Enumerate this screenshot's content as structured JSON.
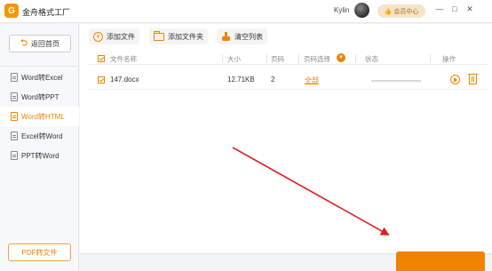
{
  "app": {
    "title": "金舟格式工厂",
    "logo_glyph": "G",
    "user": "Kylin",
    "member_label": "会员中心"
  },
  "window_controls": [
    "—",
    "□",
    "✕"
  ],
  "sidebar": {
    "back_label": "返回首页",
    "items": [
      {
        "label": "Word转Excel",
        "active": false
      },
      {
        "label": "Word转PPT",
        "active": false
      },
      {
        "label": "Word转HTML",
        "active": true
      },
      {
        "label": "Excel转Word",
        "active": false
      },
      {
        "label": "PPT转Word",
        "active": false
      }
    ],
    "bottom_button": "PDF转文件"
  },
  "toolbar": {
    "add_file": "添加文件",
    "add_folder": "添加文件夹",
    "clear_list": "清空列表"
  },
  "table": {
    "headers": {
      "name": "文件名称",
      "size": "大小",
      "pages": "页码",
      "page_select": "页码选择",
      "status": "状态",
      "actions": "操作"
    },
    "rows": [
      {
        "name": "147.docx",
        "size": "12.71KB",
        "pages": "2",
        "page_select": "全部",
        "progress": 0,
        "checked": true
      }
    ]
  },
  "colors": {
    "accent": "#f08300",
    "annotation_arrow": "#e02020"
  }
}
